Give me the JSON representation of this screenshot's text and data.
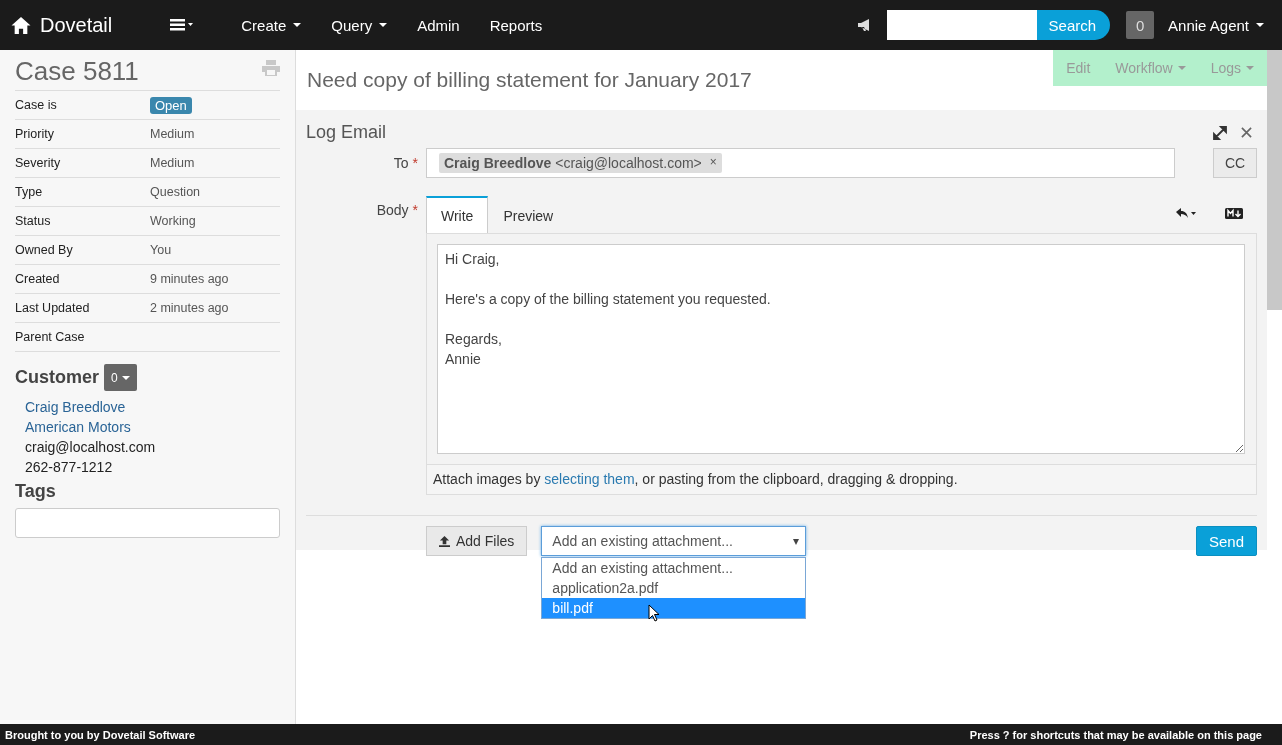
{
  "navbar": {
    "brand": "Dovetail",
    "menu": [
      {
        "label": "Create",
        "dropdown": true
      },
      {
        "label": "Query",
        "dropdown": true
      },
      {
        "label": "Admin",
        "dropdown": false
      },
      {
        "label": "Reports",
        "dropdown": false
      }
    ],
    "search_button": "Search",
    "notification_count": "0",
    "user": "Annie Agent"
  },
  "sidebar": {
    "case_title": "Case 5811",
    "fields": [
      {
        "label": "Case is",
        "value": "Open",
        "kind": "badge"
      },
      {
        "label": "Priority",
        "value": "Medium",
        "kind": "text"
      },
      {
        "label": "Severity",
        "value": "Medium",
        "kind": "text"
      },
      {
        "label": "Type",
        "value": "Question",
        "kind": "text"
      },
      {
        "label": "Status",
        "value": "Working",
        "kind": "text"
      },
      {
        "label": "Owned By",
        "value": "You",
        "kind": "text"
      },
      {
        "label": "Created",
        "value": "9 minutes ago",
        "kind": "text"
      },
      {
        "label": "Last Updated",
        "value": "2 minutes ago",
        "kind": "text"
      },
      {
        "label": "Parent Case"
      }
    ],
    "customer_heading": "Customer",
    "customer_count": "0",
    "customer": [
      {
        "text": "Craig Breedlove",
        "kind": "link"
      },
      {
        "text": "American Motors",
        "kind": "link"
      },
      {
        "text": "craig@localhost.com",
        "kind": "text"
      },
      {
        "text": "262-877-1212",
        "kind": "text"
      }
    ],
    "tags_heading": "Tags"
  },
  "page_title": "Need copy of billing statement for January 2017",
  "actions": [
    {
      "label": "Edit",
      "dropdown": false
    },
    {
      "label": "Workflow",
      "dropdown": true
    },
    {
      "label": "Logs",
      "dropdown": true
    }
  ],
  "log_email": {
    "title": "Log Email",
    "to_label": "To",
    "required_mark": "*",
    "recipients": [
      "**Craig Breedlove** <craig@localhost.com>"
    ],
    "recipient_remove": "×",
    "cc_button": "CC",
    "body_label": "Body",
    "tabs": [
      {
        "label": "Write",
        "selected": true
      },
      {
        "label": "Preview",
        "selected": false
      }
    ],
    "body": {
      "value": "Hi Craig,\n\nHere's a copy of the billing statement you requested.\n\nRegards,\nAnnie"
    },
    "attach_hint": {
      "before": "Attach images by ",
      "link": "selecting them",
      "after": ", or pasting from the clipboard, dragging & dropping."
    },
    "add_files_button": "Add Files",
    "attachment_select": {
      "value": "Add an existing attachment...",
      "expanded": true,
      "options": [
        {
          "label": "Add an existing attachment...",
          "highlighted": false
        },
        {
          "label": "application2a.pdf",
          "highlighted": false
        },
        {
          "label": "bill.pdf",
          "highlighted": true
        }
      ]
    },
    "send_button": "Send"
  },
  "footer": {
    "left": "Brought to you by Dovetail Software",
    "right": "Press ? for shortcuts that may be available on this page"
  }
}
